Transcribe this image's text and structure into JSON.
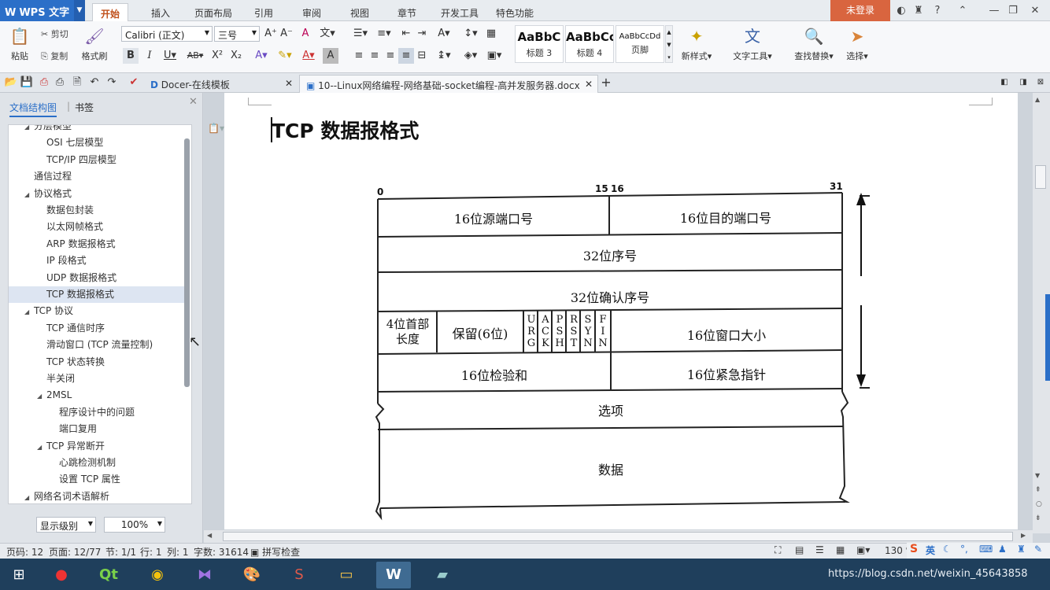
{
  "app": {
    "name": "WPS 文字",
    "login": "未登录",
    "brand_color": "#2b6fc8",
    "accent_color": "#d9653f"
  },
  "ribbon_tabs": [
    "开始",
    "插入",
    "页面布局",
    "引用",
    "审阅",
    "视图",
    "章节",
    "开发工具",
    "特色功能"
  ],
  "ribbon": {
    "paste": "粘贴",
    "cut": "剪切",
    "copy": "复制",
    "format_painter": "格式刷",
    "font_name": "Calibri (正文)",
    "font_size": "三号",
    "styles": [
      {
        "sample": "AaBbC",
        "label": "标题 3"
      },
      {
        "sample": "AaBbCc",
        "label": "标题 4"
      },
      {
        "sample": "AaBbCcDd",
        "label": "页脚"
      }
    ],
    "new_style": "新样式",
    "text_tools": "文字工具",
    "find_replace": "查找替换",
    "select": "选择"
  },
  "doc_tabs": [
    {
      "label": "Docer-在线模板"
    },
    {
      "label": "10--Linux网络编程-网络基础-socket编程-高并发服务器.docx"
    }
  ],
  "left_panel": {
    "tab_outline": "文档结构图",
    "tab_bookmarks": "书签",
    "items": [
      {
        "label": "分层模型",
        "indent": 1,
        "twisty": "◢"
      },
      {
        "label": "OSI 七层模型",
        "indent": 2,
        "twisty": ""
      },
      {
        "label": "TCP/IP 四层模型",
        "indent": 2,
        "twisty": ""
      },
      {
        "label": "通信过程",
        "indent": 1,
        "twisty": ""
      },
      {
        "label": "协议格式",
        "indent": 1,
        "twisty": "◢"
      },
      {
        "label": "数据包封装",
        "indent": 2,
        "twisty": ""
      },
      {
        "label": "以太网帧格式",
        "indent": 2,
        "twisty": ""
      },
      {
        "label": "ARP 数据报格式",
        "indent": 2,
        "twisty": ""
      },
      {
        "label": "IP 段格式",
        "indent": 2,
        "twisty": ""
      },
      {
        "label": "UDP 数据报格式",
        "indent": 2,
        "twisty": ""
      },
      {
        "label": "TCP 数据报格式",
        "indent": 2,
        "twisty": "",
        "selected": true
      },
      {
        "label": "TCP 协议",
        "indent": 1,
        "twisty": "◢"
      },
      {
        "label": "TCP 通信时序",
        "indent": 2,
        "twisty": ""
      },
      {
        "label": "滑动窗口 (TCP 流量控制)",
        "indent": 2,
        "twisty": ""
      },
      {
        "label": "TCP 状态转换",
        "indent": 2,
        "twisty": ""
      },
      {
        "label": "半关闭",
        "indent": 2,
        "twisty": ""
      },
      {
        "label": "2MSL",
        "indent": 2,
        "twisty": "◢"
      },
      {
        "label": "程序设计中的问题",
        "indent": 3,
        "twisty": ""
      },
      {
        "label": "端口复用",
        "indent": 3,
        "twisty": ""
      },
      {
        "label": "TCP 异常断开",
        "indent": 2,
        "twisty": "◢"
      },
      {
        "label": "心跳检测机制",
        "indent": 3,
        "twisty": ""
      },
      {
        "label": "设置 TCP 属性",
        "indent": 3,
        "twisty": ""
      },
      {
        "label": "网络名词术语解析",
        "indent": 1,
        "twisty": "◢"
      }
    ],
    "display_level": "显示级别",
    "zoom": "100%"
  },
  "document": {
    "heading": "TCP 数据报格式",
    "bit_labels": {
      "start": "0",
      "mid_a": "15",
      "mid_b": "16",
      "end": "31"
    },
    "fields": {
      "src_port": "16位源端口号",
      "dst_port": "16位目的端口号",
      "seq": "32位序号",
      "ack": "32位确认序号",
      "hdr_len_1": "4位首部",
      "hdr_len_2": "长度",
      "reserved": "保留(6位)",
      "window": "16位窗口大小",
      "checksum": "16位检验和",
      "urgent": "16位紧急指针",
      "options": "选项",
      "data": "数据"
    },
    "flags": [
      [
        "U",
        "R",
        "G"
      ],
      [
        "A",
        "C",
        "K"
      ],
      [
        "P",
        "S",
        "H"
      ],
      [
        "R",
        "S",
        "T"
      ],
      [
        "S",
        "Y",
        "N"
      ],
      [
        "F",
        "I",
        "N"
      ]
    ]
  },
  "status": {
    "page_code": "页码: 12",
    "pages": "页面: 12/77",
    "section": "节: 1/1",
    "row": "行: 1",
    "col": "列: 1",
    "words": "字数: 31614",
    "spell": "拼写检查",
    "zoom": "130 %"
  },
  "watermark": "https://blog.csdn.net/weixin_45643858",
  "ime": "英"
}
